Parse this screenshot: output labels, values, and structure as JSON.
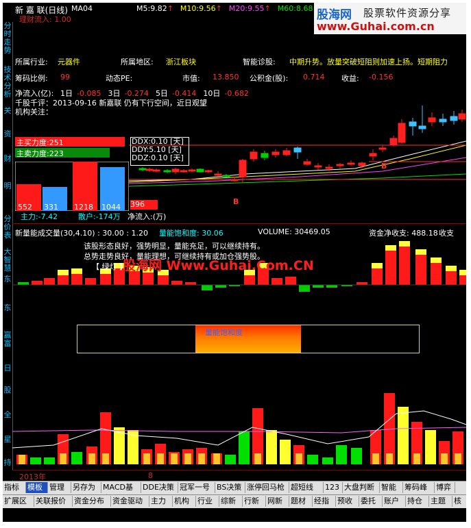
{
  "header": {
    "title": "新 嘉 联(日线)",
    "indicator": "MA04",
    "ma": [
      {
        "label": "M5:",
        "value": "9.82",
        "color": "#ffffff"
      },
      {
        "label": "M10:",
        "value": "9.56",
        "color": "#ffff00"
      },
      {
        "label": "M20:",
        "value": "9.55",
        "color": "#ff40ff"
      },
      {
        "label": "M60:",
        "value": "8.68",
        "color": "#00e000"
      }
    ],
    "arrow": "↑",
    "subline": "理财流入: 1.00"
  },
  "logo": {
    "name": "股海网",
    "slogan": "股票软件资源分享",
    "url": "www.Guhai.com.cn"
  },
  "info": {
    "industry_label": "所属行业:",
    "industry_value": "元器件",
    "region_label": "所属地区:",
    "region_value": "浙江板块",
    "diag_label": "智能诊股:",
    "diag_value": "中期升势。放量突破短阻则加速上扬。短期阻力",
    "rank_label": "筹码比例:",
    "rank_value": "99",
    "pe_label": "动态PE:",
    "mv_label": "市值:",
    "mv_value": "13.850",
    "reserve_label": "公积金(股):",
    "reserve_value": "0.714",
    "eps_label": "收益:",
    "eps_value": "-0.156",
    "netflow_label": "净流入(亿):",
    "netflow": [
      {
        "label": "1日",
        "value": "-0.085"
      },
      {
        "label": "3日",
        "value": "-0.274"
      },
      {
        "label": "5日",
        "value": "-0.414"
      },
      {
        "label": "10日",
        "value": "-0.682"
      }
    ],
    "qgqp": "千股千评：2013-09-16 新嘉联 仍有下行空间，近日观望",
    "inst": "机构关注："
  },
  "flow_panel": {
    "buy_label": "主买力度:251",
    "sell_label": "主卖力度:223",
    "ddx": [
      "DDX:0.10 [天]",
      "DDY:5.10 [天]",
      "DDZ:0.10 [天]"
    ],
    "bars": [
      "552",
      "331",
      "1218",
      "1044",
      "396"
    ],
    "footer_left": "主力:-7.42",
    "footer_mid": "散户:-174万",
    "footer_right": "净流入:(万)"
  },
  "signals": {
    "buy": "B",
    "buy2": "B"
  },
  "volume_header": {
    "left": "新量能成交量(30,4.10) : 30.00 : 1.20",
    "mid": "量能饱和度: 30.06",
    "vol": "VOLUME: 30469.05",
    "fund": "资金净收支: 488.18",
    "fund2": "收支",
    "arrow": "↑"
  },
  "comments": [
    "该股形态良好，强势明显，量能充足，可以继续持有。",
    "总势走势良好，量能理想，可继续持有或加仓强势股。"
  ],
  "hint": "【 绿灯 】",
  "watermark": "股海网 Www.Guhai.Com.CN",
  "saturation": {
    "label": "量能饱和度"
  },
  "axis": {
    "year": "2013年",
    "month": "8"
  },
  "side_tabs": [
    "分时走势",
    "技术分析",
    "关",
    "资",
    "财",
    "明",
    "分价表",
    "大智慧",
    "东",
    "东",
    "赢富",
    "日",
    "股",
    "全",
    "星",
    "持"
  ],
  "tabs_row1": [
    "指标",
    "模板",
    "管理",
    "另存为",
    "MACD基本",
    "DDE决策",
    "冠军一号",
    "BS决策",
    "涨停回马枪",
    "超短线",
    "123",
    "大盘判断",
    "智能",
    "筹码峰",
    "博弈"
  ],
  "tabs_row2": [
    "扩展区",
    "关联报价",
    "资金分布",
    "资金驱动",
    "主力",
    "机构",
    "行业",
    "综新",
    "行新",
    "网新",
    "题材",
    "经指",
    "预收",
    "委托",
    "账户",
    "持仓",
    "主题",
    "核题"
  ],
  "active_tab": "模板"
}
